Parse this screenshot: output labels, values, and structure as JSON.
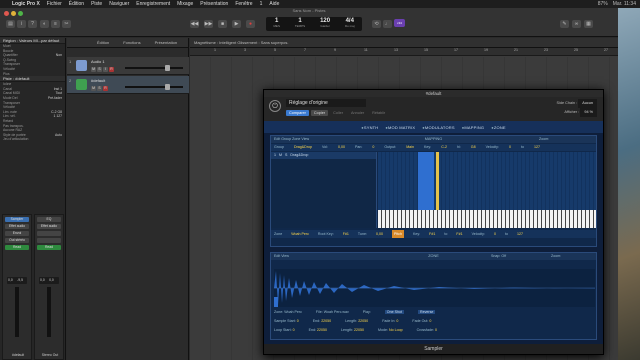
{
  "menubar": {
    "app": "Logic Pro X",
    "items": [
      "Fichier",
      "Édition",
      "Piste",
      "Naviguer",
      "Enregistrement",
      "Mixage",
      "Présentation",
      "Fenêtre",
      "1",
      "Aide"
    ],
    "right": [
      "87%",
      "Mar. 11:34"
    ]
  },
  "window": {
    "title": "Sans Nom - Pistes"
  },
  "lcd": {
    "bar": "1",
    "beat": "1",
    "tempo": "120",
    "tempo_label": "Garder",
    "sig": "4/4",
    "key": "Do maj",
    "label_mes": "MES",
    "label_temps": "TEMPS"
  },
  "usb_badge": "c34",
  "inspector": {
    "region_header": "Région : Valeurs MI...par défaut",
    "region_rows": [
      {
        "k": "Muet",
        "v": ""
      },
      {
        "k": "Boucle",
        "v": ""
      },
      {
        "k": "Quantifier",
        "v": "Non"
      },
      {
        "k": "Q-Swing",
        "v": ""
      },
      {
        "k": "Transposer",
        "v": ""
      },
      {
        "k": "Vélocité",
        "v": ""
      },
      {
        "k": "Plus",
        "v": ""
      }
    ],
    "track_header": "Piste : #default",
    "track_rows": [
      {
        "k": "Icône",
        "v": ""
      },
      {
        "k": "Canal",
        "v": "Inst 1"
      },
      {
        "k": "Canal MIDI",
        "v": "Tout"
      },
      {
        "k": "Mode Del",
        "v": "Pré-fader"
      },
      {
        "k": "Transposer",
        "v": ""
      },
      {
        "k": "Vélocité",
        "v": ""
      },
      {
        "k": "Lim. note",
        "v": "C-2  G8"
      },
      {
        "k": "Lim. vél.",
        "v": "1  127"
      },
      {
        "k": "Retard",
        "v": ""
      },
      {
        "k": "Pas transpos.",
        "v": ""
      },
      {
        "k": "Aucune RAZ",
        "v": ""
      },
      {
        "k": "Style de portée",
        "v": "Auto"
      },
      {
        "k": "Jeu d'articulation",
        "v": ""
      }
    ],
    "strip1": {
      "buttons": [
        "Sampler",
        "Effet audio",
        "Envoi",
        "Out stéréo",
        "Read"
      ],
      "vals": [
        "0,0",
        "-9,5"
      ],
      "name": "#default"
    },
    "strip2": {
      "buttons": [
        "EQ",
        "Effet audio",
        "",
        "",
        "Read"
      ],
      "vals": [
        "0,0",
        "0,0"
      ],
      "name": "Stereo Out"
    }
  },
  "track_tools": [
    "Édition",
    "Fonctions",
    "Présentation"
  ],
  "tracks": [
    {
      "num": "1",
      "name": "Audio 1",
      "color": "#7d9bd0",
      "selected": false
    },
    {
      "num": "2",
      "name": "#default",
      "color": "#3fa050",
      "selected": true
    }
  ],
  "arrange": {
    "toolbar": "Magnétisme : Intelligent    Glissement : Sans superpos.",
    "ruler": [
      "1",
      "3",
      "5",
      "7",
      "9",
      "11",
      "13",
      "15",
      "17",
      "19",
      "21",
      "23",
      "25",
      "27"
    ]
  },
  "sampler": {
    "window_title": "#default",
    "preset": "Réglage d'origine",
    "buttons": [
      "Comparer",
      "Copier",
      "Coller",
      "Annuler",
      "Rétablir"
    ],
    "sidechain_label": "Side Chain :",
    "sidechain_val": "Aucun",
    "afficher_label": "Afficher :",
    "afficher_val": "94 %",
    "tabs": [
      "SYNTH",
      "MOD MATRIX",
      "MODULATORS",
      "MAPPING",
      "ZONE"
    ],
    "mapping": {
      "title": "MAPPING",
      "menu": "Edit  Group  Zone  View",
      "zoom_label": "Zoom:",
      "header_row": [
        {
          "k": "Group",
          "v": "Drag&Drop"
        },
        {
          "k": "Vol:",
          "v": "0,00"
        },
        {
          "k": "Pan:",
          "v": "0"
        },
        {
          "k": "Output:",
          "v": "Main"
        },
        {
          "k": "Key:",
          "v": "C-2"
        },
        {
          "k": "hi:",
          "v": "G8"
        },
        {
          "k": "Velocity:",
          "v": "0"
        },
        {
          "k": "to",
          "v": "127"
        }
      ],
      "group": {
        "num": "1",
        "name": "Drag&Drop"
      },
      "zone_row": [
        {
          "k": "Zone",
          "v": "Woah Perc"
        },
        {
          "k": "Root Key:",
          "v": "F#1"
        },
        {
          "k": "Tune:",
          "v": "0,00"
        },
        {
          "k": "Pitch",
          "v": ""
        },
        {
          "k": "Key:",
          "v": "F#1"
        },
        {
          "k": "to",
          "v": "F#1"
        },
        {
          "k": "Velocity:",
          "v": "0"
        },
        {
          "k": "to",
          "v": "127"
        }
      ]
    },
    "zone": {
      "title": "ZONE",
      "menu": "Edit  View",
      "snap": "Snap:  Off",
      "zoom": "Zoom:",
      "zone_name": "Zone:  Woah Perc",
      "file": "File:  Woah Perc.wav",
      "play": "Play:",
      "oneshot": "One Shot",
      "reverse": "Reverse",
      "rows": [
        [
          {
            "k": "Sample Start:",
            "v": "0"
          },
          {
            "k": "End:",
            "v": "22050"
          },
          {
            "k": "Length:",
            "v": "22050"
          },
          {
            "k": "Fade In:",
            "v": "0"
          },
          {
            "k": "Fade Out:",
            "v": "0"
          }
        ],
        [
          {
            "k": "Loop Start:",
            "v": "0"
          },
          {
            "k": "End:",
            "v": "22050"
          },
          {
            "k": "Length:",
            "v": "22050"
          },
          {
            "k": "Mode:",
            "v": "No Loop"
          },
          {
            "k": "Crossfade:",
            "v": "0"
          }
        ]
      ]
    },
    "footer": "Sampler"
  }
}
